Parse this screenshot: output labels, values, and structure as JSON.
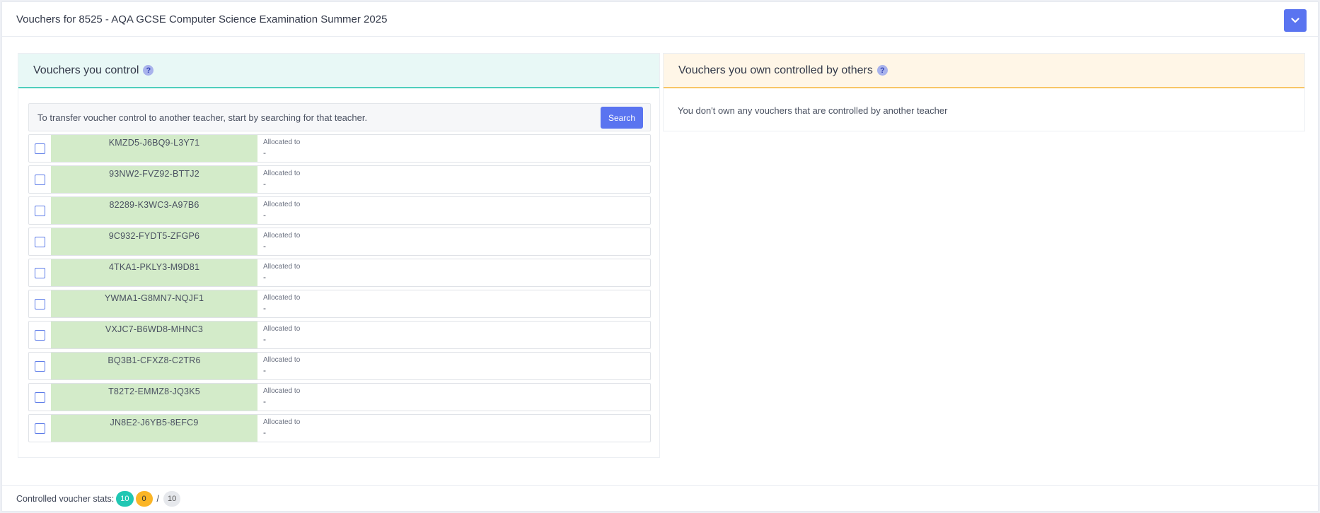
{
  "header": {
    "title": "Vouchers for 8525 - AQA GCSE Computer Science Examination Summer 2025",
    "collapse_icon": "chevron-down-icon"
  },
  "left_panel": {
    "title": "Vouchers you control",
    "help_symbol": "?",
    "transfer_text": "To transfer voucher control to another teacher, start by searching for that teacher.",
    "search_label": "Search",
    "allocated_label": "Allocated to",
    "vouchers": [
      {
        "code": "KMZD5-J6BQ9-L3Y71",
        "allocated": "-"
      },
      {
        "code": "93NW2-FVZ92-BTTJ2",
        "allocated": "-"
      },
      {
        "code": "82289-K3WC3-A97B6",
        "allocated": "-"
      },
      {
        "code": "9C932-FYDT5-ZFGP6",
        "allocated": "-"
      },
      {
        "code": "4TKA1-PKLY3-M9D81",
        "allocated": "-"
      },
      {
        "code": "YWMA1-G8MN7-NQJF1",
        "allocated": "-"
      },
      {
        "code": "VXJC7-B6WD8-MHNC3",
        "allocated": "-"
      },
      {
        "code": "BQ3B1-CFXZ8-C2TR6",
        "allocated": "-"
      },
      {
        "code": "T82T2-EMMZ8-JQ3K5",
        "allocated": "-"
      },
      {
        "code": "JN8E2-J6YB5-8EFC9",
        "allocated": "-"
      }
    ]
  },
  "right_panel": {
    "title": "Vouchers you own controlled by others",
    "help_symbol": "?",
    "empty_message": "You don't own any vouchers that are controlled by another teacher"
  },
  "footer": {
    "label": "Controlled voucher stats:",
    "stat_a": "10",
    "stat_b": "0",
    "separator": "/",
    "stat_total": "10"
  },
  "colors": {
    "accent": "#5a74f0",
    "teal": "#21c7b3",
    "orange": "#fbb526",
    "voucher_code_bg": "#d3ebc9"
  }
}
